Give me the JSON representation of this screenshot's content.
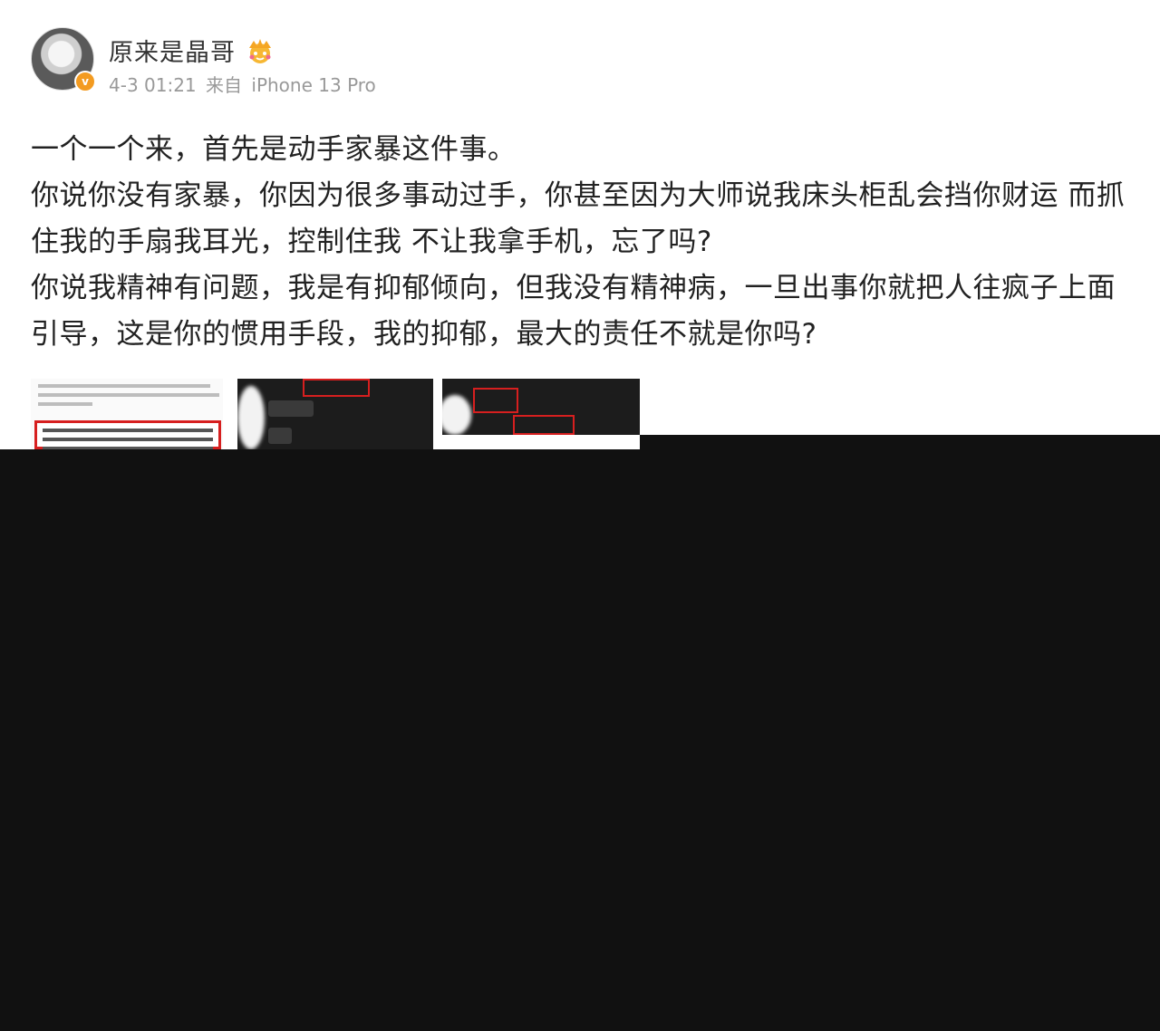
{
  "post": {
    "username": "原来是晶哥",
    "timestamp": "4-3 01:21",
    "source_prefix": "来自",
    "device": "iPhone 13 Pro",
    "paragraphs": [
      "一个一个来，首先是动手家暴这件事。",
      "你说你没有家暴，你因为很多事动过手，你甚至因为大师说我床头柜乱会挡你财运 而抓住我的手扇我耳光，控制住我 不让我拿手机，忘了吗?",
      "你说我精神有问题，我是有抑郁倾向，但我没有精神病，一旦出事你就把人往疯子上面引导，这是你的惯用手段，我的抑郁，最大的责任不就是你吗?"
    ]
  },
  "icons": {
    "verify": "verified-badge-icon",
    "crown": "crown-icon"
  },
  "colors": {
    "username": "#333333",
    "meta": "#999999",
    "body_text": "#222222",
    "verify_badge": "#f39b21",
    "highlight_box": "#d61f1f",
    "overlay": "#111111"
  }
}
